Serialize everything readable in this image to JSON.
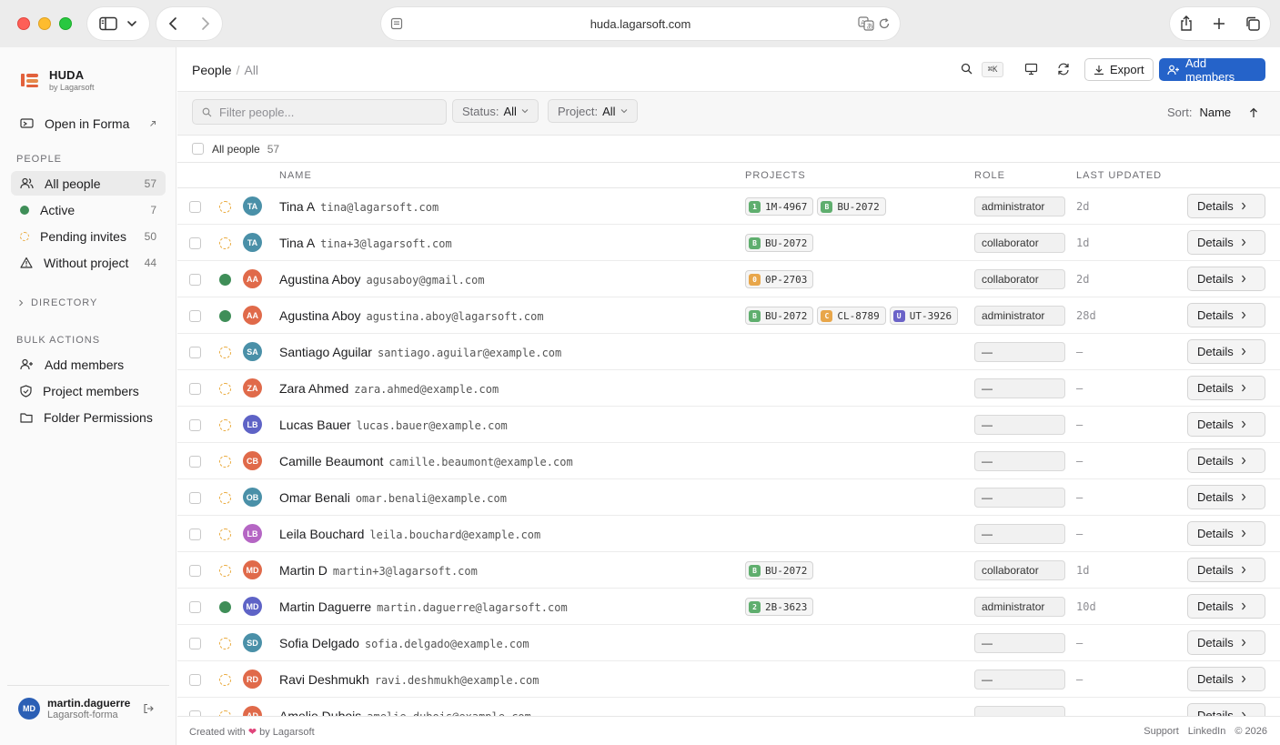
{
  "browser": {
    "url": "huda.lagarsoft.com"
  },
  "brand": {
    "name": "HUDA",
    "sub": "by Lagarsoft"
  },
  "sidebar": {
    "open_in": "Open in Forma",
    "people_section": "PEOPLE",
    "people": [
      {
        "label": "All people",
        "count": "57"
      },
      {
        "label": "Active",
        "count": "7"
      },
      {
        "label": "Pending invites",
        "count": "50"
      },
      {
        "label": "Without project",
        "count": "44"
      }
    ],
    "directory": "DIRECTORY",
    "bulk_section": "BULK ACTIONS",
    "bulk": [
      {
        "label": "Add members"
      },
      {
        "label": "Project members"
      },
      {
        "label": "Folder Permissions"
      }
    ],
    "user": {
      "initials": "MD",
      "name": "martin.daguerre",
      "org": "Lagarsoft-forma"
    }
  },
  "header": {
    "crumb_root": "People",
    "crumb_sep": "/",
    "crumb_current": "All",
    "shortcut": "⌘K",
    "export_label": "Export",
    "add_label": "Add members"
  },
  "toolbar": {
    "filter_placeholder": "Filter people...",
    "status_label": "Status:",
    "status_value": "All",
    "project_label": "Project:",
    "project_value": "All",
    "sort_label": "Sort:",
    "sort_value": "Name"
  },
  "all_row": {
    "label": "All people",
    "count": "57"
  },
  "columns": {
    "name": "NAME",
    "projects": "PROJECTS",
    "role": "ROLE",
    "updated": "LAST UPDATED"
  },
  "details_label": "Details",
  "colors": {
    "accent": "#2563c9",
    "active": "#3f8e58",
    "pending": "#e9a93b"
  },
  "rows": [
    {
      "status": "pending",
      "initials": "TA",
      "av": "#4a90a8",
      "name": "Tina A",
      "email": "tina@lagarsoft.com",
      "projects": [
        {
          "b": "1",
          "c": "#5fae6e",
          "code": "1M-4967"
        },
        {
          "b": "B",
          "c": "#5fae6e",
          "code": "BU-2072"
        }
      ],
      "role": "administrator",
      "updated": "2d"
    },
    {
      "status": "pending",
      "initials": "TA",
      "av": "#4a90a8",
      "name": "Tina A",
      "email": "tina+3@lagarsoft.com",
      "projects": [
        {
          "b": "B",
          "c": "#5fae6e",
          "code": "BU-2072"
        }
      ],
      "role": "collaborator",
      "updated": "1d"
    },
    {
      "status": "active",
      "initials": "AA",
      "av": "#e06a4a",
      "name": "Agustina Aboy",
      "email": "agusaboy@gmail.com",
      "projects": [
        {
          "b": "0",
          "c": "#e8a64a",
          "code": "0P-2703"
        }
      ],
      "role": "collaborator",
      "updated": "2d"
    },
    {
      "status": "active",
      "initials": "AA",
      "av": "#e06a4a",
      "name": "Agustina Aboy",
      "email": "agustina.aboy@lagarsoft.com",
      "projects": [
        {
          "b": "B",
          "c": "#5fae6e",
          "code": "BU-2072"
        },
        {
          "b": "C",
          "c": "#e8a64a",
          "code": "CL-8789"
        },
        {
          "b": "U",
          "c": "#6b63c8",
          "code": "UT-3926"
        }
      ],
      "role": "administrator",
      "updated": "28d"
    },
    {
      "status": "pending",
      "initials": "SA",
      "av": "#4a90a8",
      "name": "Santiago Aguilar",
      "email": "santiago.aguilar@example.com",
      "projects": [],
      "role": "—",
      "updated": "—"
    },
    {
      "status": "pending",
      "initials": "ZA",
      "av": "#e06a4a",
      "name": "Zara Ahmed",
      "email": "zara.ahmed@example.com",
      "projects": [],
      "role": "—",
      "updated": "—"
    },
    {
      "status": "pending",
      "initials": "LB",
      "av": "#5e63c6",
      "name": "Lucas Bauer",
      "email": "lucas.bauer@example.com",
      "projects": [],
      "role": "—",
      "updated": "—"
    },
    {
      "status": "pending",
      "initials": "CB",
      "av": "#e06a4a",
      "name": "Camille Beaumont",
      "email": "camille.beaumont@example.com",
      "projects": [],
      "role": "—",
      "updated": "—"
    },
    {
      "status": "pending",
      "initials": "OB",
      "av": "#4a90a8",
      "name": "Omar Benali",
      "email": "omar.benali@example.com",
      "projects": [],
      "role": "—",
      "updated": "—"
    },
    {
      "status": "pending",
      "initials": "LB",
      "av": "#b566c4",
      "name": "Leila Bouchard",
      "email": "leila.bouchard@example.com",
      "projects": [],
      "role": "—",
      "updated": "—"
    },
    {
      "status": "pending",
      "initials": "MD",
      "av": "#e06a4a",
      "name": "Martin D",
      "email": "martin+3@lagarsoft.com",
      "projects": [
        {
          "b": "B",
          "c": "#5fae6e",
          "code": "BU-2072"
        }
      ],
      "role": "collaborator",
      "updated": "1d"
    },
    {
      "status": "active",
      "initials": "MD",
      "av": "#5e63c6",
      "name": "Martin Daguerre",
      "email": "martin.daguerre@lagarsoft.com",
      "projects": [
        {
          "b": "2",
          "c": "#5fae6e",
          "code": "2B-3623"
        }
      ],
      "role": "administrator",
      "updated": "10d"
    },
    {
      "status": "pending",
      "initials": "SD",
      "av": "#4a90a8",
      "name": "Sofia Delgado",
      "email": "sofia.delgado@example.com",
      "projects": [],
      "role": "—",
      "updated": "—"
    },
    {
      "status": "pending",
      "initials": "RD",
      "av": "#e06a4a",
      "name": "Ravi Deshmukh",
      "email": "ravi.deshmukh@example.com",
      "projects": [],
      "role": "—",
      "updated": "—"
    },
    {
      "status": "pending",
      "initials": "AD",
      "av": "#e06a4a",
      "name": "Amelie Dubois",
      "email": "amelie.dubois@example.com",
      "projects": [],
      "role": "—",
      "updated": "—"
    }
  ],
  "footer": {
    "created_prefix": "Created with",
    "heart": "❤",
    "created_suffix": "by Lagarsoft",
    "support": "Support",
    "linkedin": "LinkedIn",
    "copyright": "© 2026"
  }
}
